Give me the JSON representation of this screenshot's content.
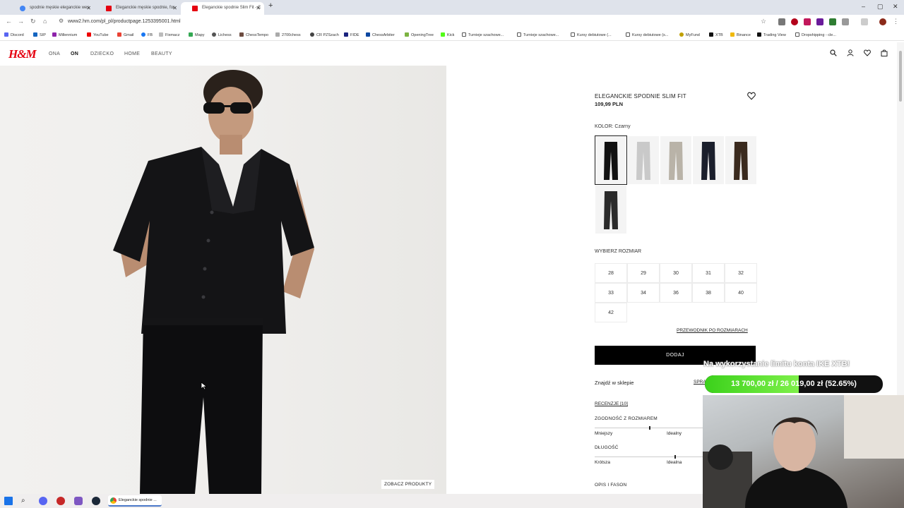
{
  "browser": {
    "tabs": [
      {
        "label": "spodnie męskie eleganckie wes"
      },
      {
        "label": "Eleganckie męskie spodnie, for"
      },
      {
        "label": "Eleganckie spodnie Slim Fit - C"
      }
    ],
    "url": "www2.hm.com/pl_pl/productpage.1253395001.html",
    "bookmarks": [
      "Discord",
      "SIP",
      "Millennium",
      "YouTube",
      "Gmail",
      "FB",
      "Fixmacz",
      "Mapy",
      "Lichess",
      "ChessTempo",
      "2700chess",
      "CR PZSzach",
      "FIDE",
      "ChessArbiter",
      "OpeningTree",
      "Kick",
      "Turnieje szachowe...",
      "Turnieje szachowe...",
      "Kursy debiutowe (...",
      "Kursy debiutowe (s...",
      "MyFund",
      "XTB",
      "Binance",
      "Trading View",
      "Dropshipping - cle..."
    ]
  },
  "site": {
    "logo": "H&M",
    "nav": [
      "ONA",
      "ON",
      "DZIECKO",
      "HOME",
      "BEAUTY"
    ]
  },
  "product": {
    "title": "ELEGANCKIE SPODNIE SLIM FIT",
    "price": "109,99 PLN",
    "color_label": "KOLOR: Czarny",
    "swatches": [
      {
        "name": "czarny",
        "color": "#111111"
      },
      {
        "name": "jasnoszary",
        "color": "#c9c9c9"
      },
      {
        "name": "beżowy",
        "color": "#b9b3a8"
      },
      {
        "name": "granatowy",
        "color": "#1b1f2c"
      },
      {
        "name": "brązowy",
        "color": "#3a2a1e"
      },
      {
        "name": "grafitowy",
        "color": "#2b2b2b"
      }
    ],
    "size_label": "WYBIERZ ROZMIAR",
    "sizes": [
      "28",
      "29",
      "30",
      "31",
      "32",
      "33",
      "34",
      "36",
      "38",
      "40",
      "42"
    ],
    "size_guide": "PRZEWODNIK PO ROZMIARACH",
    "add_button": "DODAJ",
    "find_in_store": "Znajdź w sklepie",
    "check_link": "SPRA",
    "reviews": "RECENZJE [10]",
    "fit_size": {
      "label": "ZGODNOŚĆ Z ROZMIAREM",
      "left": "Mniejszy",
      "right": "Idealny",
      "value": 0.5
    },
    "fit_length": {
      "label": "DŁUGOŚĆ",
      "left": "Krótsza",
      "right": "Idealna",
      "value": 0.74
    },
    "description": "OPIS I FASON",
    "see_products": "ZOBACZ PRODUKTY"
  },
  "overlay": {
    "xtb_text": "Na wykorzystanie limitu konta IKE XTB!",
    "xtb_value": "13 700,00 zł / 26 019,00 zł (52.65%)",
    "xtb_progress": 0.5265
  },
  "taskbar": {
    "app_label": "Eleganckie spodnie ..."
  }
}
